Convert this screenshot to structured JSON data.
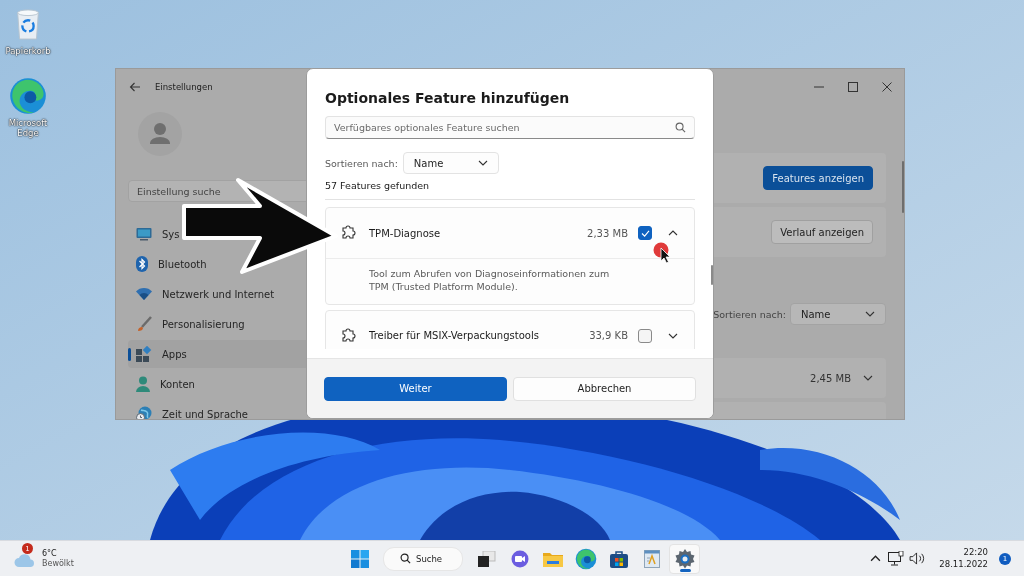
{
  "desktop_icons": [
    {
      "kind": "bin",
      "label": "Papierkorb"
    },
    {
      "kind": "edge",
      "label": "Microsoft Edge"
    }
  ],
  "settings_window": {
    "title": "Einstellungen",
    "search": {
      "placeholder": "Einstellung suche"
    },
    "nav": [
      {
        "kind": "monitor",
        "label": "Sys",
        "selected": false
      },
      {
        "kind": "bluetooth",
        "label": "Bluetooth",
        "selected": false
      },
      {
        "kind": "wifi",
        "label": "Netzwerk und Internet",
        "selected": false
      },
      {
        "kind": "brush",
        "label": "Personalisierung",
        "selected": false
      },
      {
        "kind": "apps",
        "label": "Apps",
        "selected": true
      },
      {
        "kind": "person",
        "label": "Konten",
        "selected": false
      },
      {
        "kind": "globe",
        "label": "Zeit und Sprache",
        "selected": false
      }
    ],
    "buttons": [
      {
        "label": "Features anzeigen",
        "primary": true
      },
      {
        "label": "Verlauf anzeigen",
        "primary": false
      }
    ],
    "sort": {
      "label": "Sortieren nach:",
      "value": "Name"
    },
    "feature_size": "2,45 MB"
  },
  "dialog": {
    "title": "Optionales Feature hinzufügen",
    "search": {
      "placeholder": "Verfügbares optionales Feature suchen"
    },
    "sort": {
      "label": "Sortieren nach:",
      "value": "Name"
    },
    "count": "57 Features gefunden",
    "features": [
      {
        "name": "TPM-Diagnose",
        "size": "2,33 MB",
        "checked": true,
        "expanded": true,
        "description": "Tool zum Abrufen von Diagnoseinformationen zum TPM (Trusted Platform Module)."
      },
      {
        "name": "Treiber für MSIX-Verpackungstools",
        "size": "33,9 KB",
        "checked": false,
        "expanded": false
      }
    ],
    "buttons": [
      {
        "label": "Weiter",
        "primary": true
      },
      {
        "label": "Abbrechen",
        "primary": false
      }
    ]
  },
  "taskbar": {
    "weather": {
      "temperature": "6°C",
      "condition": "Bewölkt",
      "badge": "1"
    },
    "apps": [
      {
        "kind": "start",
        "active": false
      },
      {
        "kind": "search",
        "label": "Suche",
        "active": false
      },
      {
        "kind": "taskview",
        "active": false
      },
      {
        "kind": "chat",
        "active": false
      },
      {
        "kind": "folder",
        "active": false
      },
      {
        "kind": "edge",
        "active": false
      },
      {
        "kind": "store",
        "active": false
      },
      {
        "kind": "notepad",
        "active": false
      },
      {
        "kind": "gear",
        "active": true
      }
    ],
    "tray": {
      "time": "22:20",
      "date": "28.11.2022",
      "badge": "1"
    }
  }
}
